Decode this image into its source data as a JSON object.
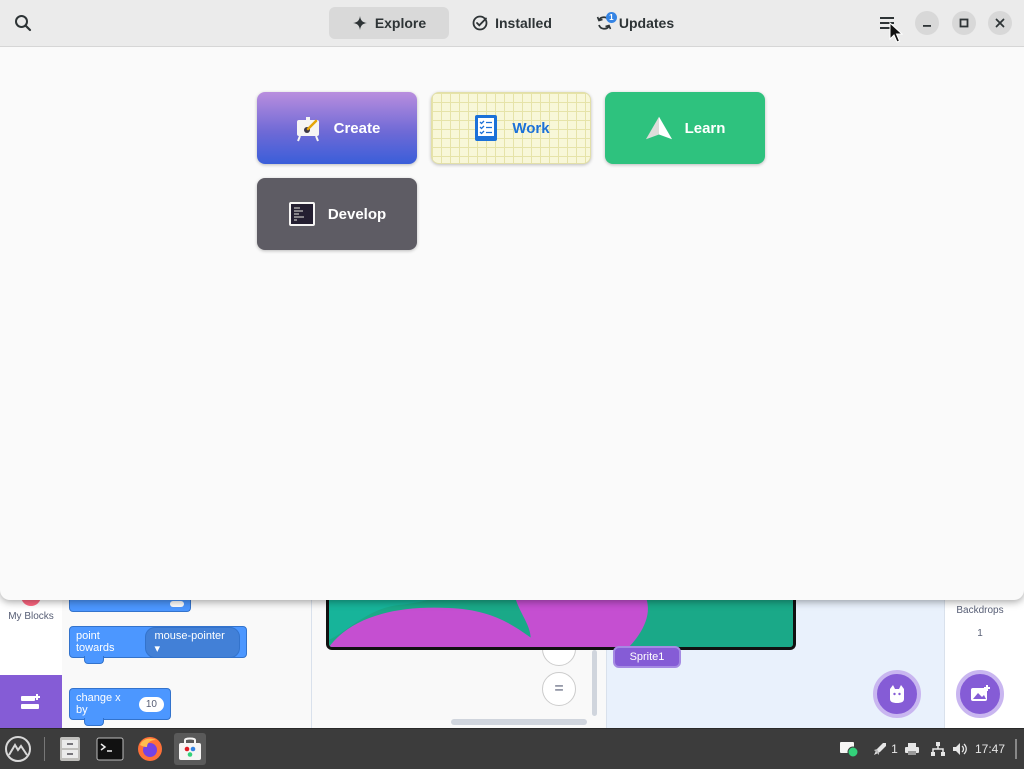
{
  "window": {
    "tabs": [
      {
        "label": "Explore",
        "icon": "sparkle-icon",
        "active": true
      },
      {
        "label": "Installed",
        "icon": "check-circle-icon",
        "active": false
      },
      {
        "label": "Updates",
        "icon": "refresh-icon",
        "active": false,
        "badge": "1"
      }
    ],
    "categories": [
      {
        "label": "Create",
        "icon": "paint-easel-icon",
        "color": "#6f6ad6"
      },
      {
        "label": "Work",
        "icon": "checklist-icon",
        "color": "#1c71d8"
      },
      {
        "label": "Learn",
        "icon": "paper-plane-icon",
        "color": "#2ec27e"
      },
      {
        "label": "Develop",
        "icon": "terminal-icon",
        "color": "#5e5c64"
      }
    ]
  },
  "background_app": {
    "category_label": "My Blocks",
    "blocks": {
      "point_towards": "point towards",
      "point_towards_value": "mouse-pointer",
      "change_x": "change x by",
      "change_x_value": "10"
    },
    "sprite_name": "Sprite1",
    "backdrops_label": "Backdrops",
    "backdrops_count": "1",
    "zoom_reset_symbol": "="
  },
  "taskbar": {
    "apps": [
      "menu-logo-icon",
      "file-manager-icon",
      "terminal-icon",
      "firefox-icon",
      "software-center-icon"
    ],
    "notification_count": "1",
    "clock": "17:47"
  }
}
